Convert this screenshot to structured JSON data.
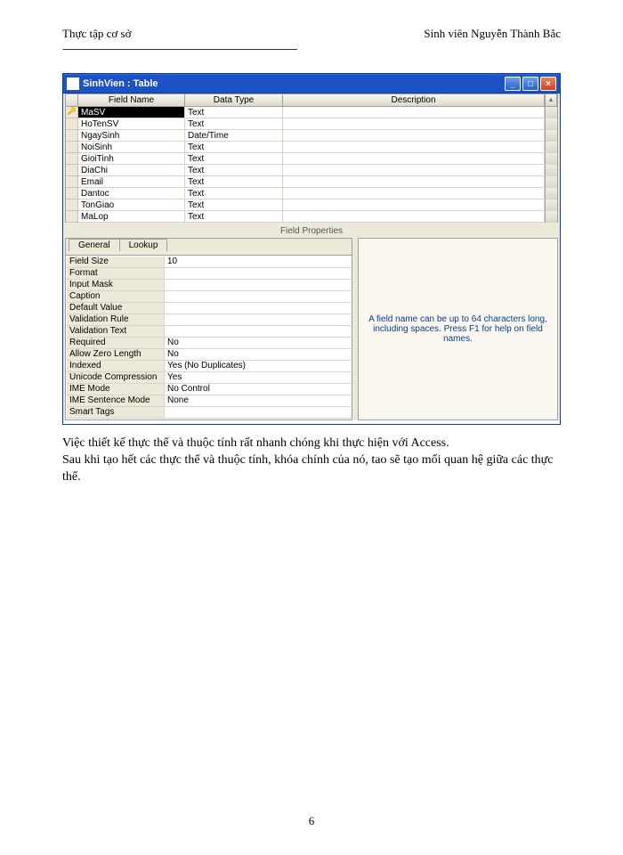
{
  "header": {
    "left": "Thực tập cơ sở",
    "right": "Sinh viên Nguyễn Thành Bắc"
  },
  "window": {
    "title": "SinhVien : Table",
    "columns": {
      "c1": "Field Name",
      "c2": "Data Type",
      "c3": "Description"
    },
    "rows": [
      {
        "name": "MaSV",
        "type": "Text",
        "desc": ""
      },
      {
        "name": "HoTenSV",
        "type": "Text",
        "desc": ""
      },
      {
        "name": "NgaySinh",
        "type": "Date/Time",
        "desc": ""
      },
      {
        "name": "NoiSinh",
        "type": "Text",
        "desc": ""
      },
      {
        "name": "GioiTinh",
        "type": "Text",
        "desc": ""
      },
      {
        "name": "DiaChi",
        "type": "Text",
        "desc": ""
      },
      {
        "name": "Email",
        "type": "Text",
        "desc": ""
      },
      {
        "name": "Dantoc",
        "type": "Text",
        "desc": ""
      },
      {
        "name": "TonGiao",
        "type": "Text",
        "desc": ""
      },
      {
        "name": "MaLop",
        "type": "Text",
        "desc": ""
      }
    ],
    "section_label": "Field Properties",
    "tabs": {
      "general": "General",
      "lookup": "Lookup"
    },
    "props": [
      {
        "label": "Field Size",
        "value": "10"
      },
      {
        "label": "Format",
        "value": ""
      },
      {
        "label": "Input Mask",
        "value": ""
      },
      {
        "label": "Caption",
        "value": ""
      },
      {
        "label": "Default Value",
        "value": ""
      },
      {
        "label": "Validation Rule",
        "value": ""
      },
      {
        "label": "Validation Text",
        "value": ""
      },
      {
        "label": "Required",
        "value": "No"
      },
      {
        "label": "Allow Zero Length",
        "value": "No"
      },
      {
        "label": "Indexed",
        "value": "Yes (No Duplicates)"
      },
      {
        "label": "Unicode Compression",
        "value": "Yes"
      },
      {
        "label": "IME Mode",
        "value": "No Control"
      },
      {
        "label": "IME Sentence Mode",
        "value": "None"
      },
      {
        "label": "Smart Tags",
        "value": ""
      }
    ],
    "hint": "A field name can be up to 64 characters long, including spaces.  Press F1 for help on field names."
  },
  "paragraphs": {
    "p1": "Việc thiết kế thực thể và thuộc tính rất nhanh chóng khi thực hiện với Access.",
    "p2": "Sau khi tạo hết các thực thể và thuộc tính, khóa chính của nó, tao sẽ tạo mối quan hệ giữa các thực thể."
  },
  "page_number": "6",
  "key_icon": "🔑"
}
